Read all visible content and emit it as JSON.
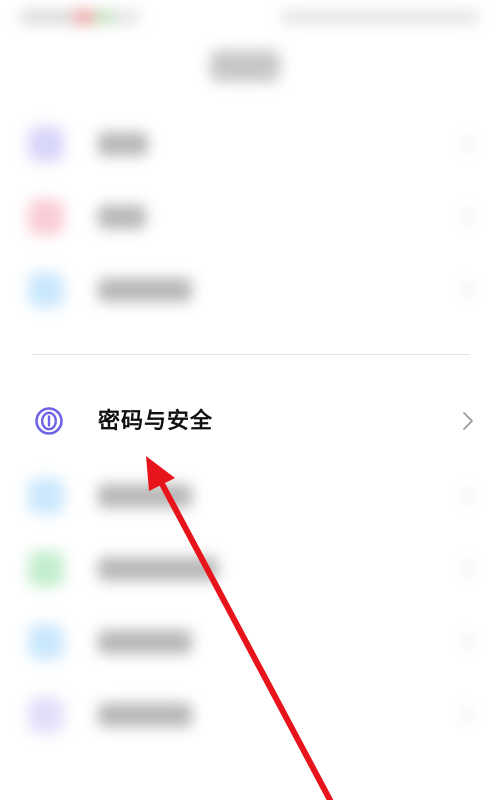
{
  "colors": {
    "accent_icon": "#6f63e6",
    "arrow": "#e8141c",
    "text_primary": "#111111",
    "chevron": "#9a9a9a"
  },
  "focused_item": {
    "label": "密码与安全",
    "icon": "fingerprint-icon",
    "trailing_icon": "chevron-right-icon"
  },
  "annotation": {
    "type": "arrow",
    "points_to": "focused_item"
  },
  "blurred_rows_above": [
    {
      "icon_color": "#b9b3f5"
    },
    {
      "icon_color": "#f4a3b3"
    },
    {
      "icon_color": "#9fd4fb"
    }
  ],
  "blurred_rows_below": [
    {
      "icon_color": "#9fd4fb"
    },
    {
      "icon_color": "#92e0a3"
    },
    {
      "icon_color": "#9fd4fb"
    },
    {
      "icon_color": "#c9c4f5"
    }
  ]
}
